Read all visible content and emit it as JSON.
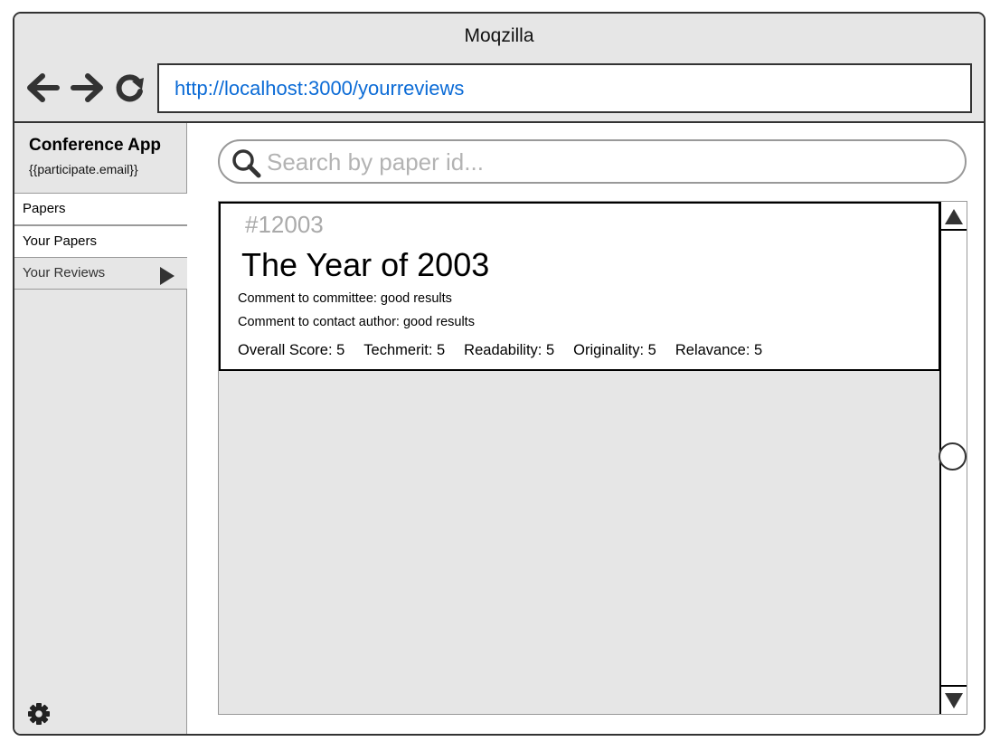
{
  "browser": {
    "title": "Moqzilla",
    "url": "http://localhost:3000/yourreviews",
    "icons": {
      "back": "arrow-left-icon",
      "forward": "arrow-right-icon",
      "reload": "reload-icon"
    }
  },
  "sidebar": {
    "app_title": "Conference App",
    "user_email": "{{participate.email}}",
    "items": [
      {
        "label": "Papers"
      },
      {
        "label": "Your Papers"
      },
      {
        "label": "Your Reviews",
        "active": true
      }
    ],
    "settings_icon": "gear-icon"
  },
  "search": {
    "placeholder": "Search by paper id...",
    "value": ""
  },
  "reviews": [
    {
      "id": "#12003",
      "title": "The Year of 2003",
      "comment_committee": "Comment to committee: good results",
      "comment_author": "Comment to contact author: good results",
      "scores": {
        "overall": "Overall Score: 5",
        "techmerit": "Techmerit: 5",
        "readability": "Readability: 5",
        "originality": "Originality: 5",
        "relavance": "Relavance: 5"
      }
    }
  ],
  "colors": {
    "chrome": "#e6e6e6",
    "url_text": "#0b6bd6",
    "placeholder": "#b3b3b3",
    "paper_id": "#aaaaaa"
  }
}
